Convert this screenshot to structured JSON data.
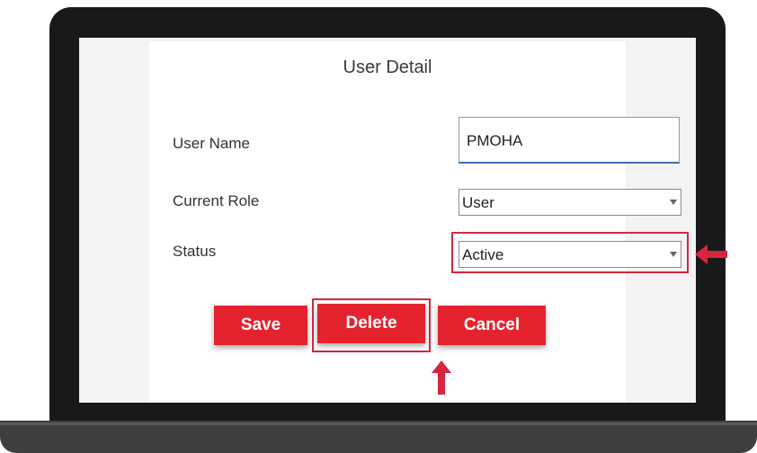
{
  "form": {
    "title": "User Detail",
    "user_name": {
      "label": "User Name",
      "value": "PMOHA"
    },
    "current_role": {
      "label": "Current Role",
      "selected": "User"
    },
    "status": {
      "label": "Status",
      "selected": "Active"
    }
  },
  "buttons": {
    "save": "Save",
    "delete": "Delete",
    "cancel": "Cancel"
  },
  "colors": {
    "accent": "#e4232f",
    "highlight": "#d7263d",
    "laptop_frame": "#191919"
  },
  "icons": {
    "status_pointer": "arrow-left-icon",
    "delete_pointer": "arrow-up-icon",
    "dropdown": "chevron-down-icon"
  }
}
